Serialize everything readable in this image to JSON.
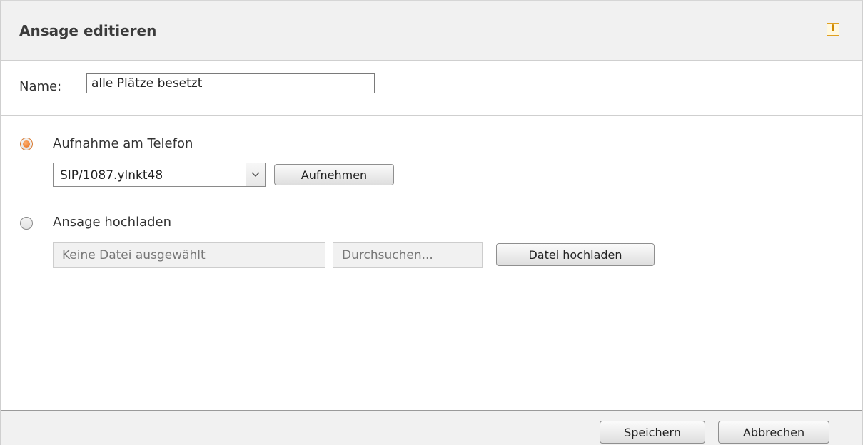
{
  "dialog": {
    "title": "Ansage editieren",
    "info_icon": "info-icon"
  },
  "name_field": {
    "label": "Name:",
    "value": "alle Plätze besetzt"
  },
  "options": {
    "record_on_phone": {
      "label": "Aufnahme am Telefon",
      "selected": true,
      "device_select_value": "SIP/1087.ylnkt48",
      "record_button": "Aufnehmen"
    },
    "upload": {
      "label": "Ansage hochladen",
      "selected": false,
      "file_placeholder": "Keine Datei ausgewählt",
      "browse_button": "Durchsuchen...",
      "upload_button": "Datei hochladen"
    }
  },
  "footer": {
    "save_button": "Speichern",
    "cancel_button": "Abbrechen"
  },
  "colors": {
    "header_bg": "#f1f1f1",
    "radio_accent": "#e46a18",
    "info_icon": "#e0a020"
  }
}
